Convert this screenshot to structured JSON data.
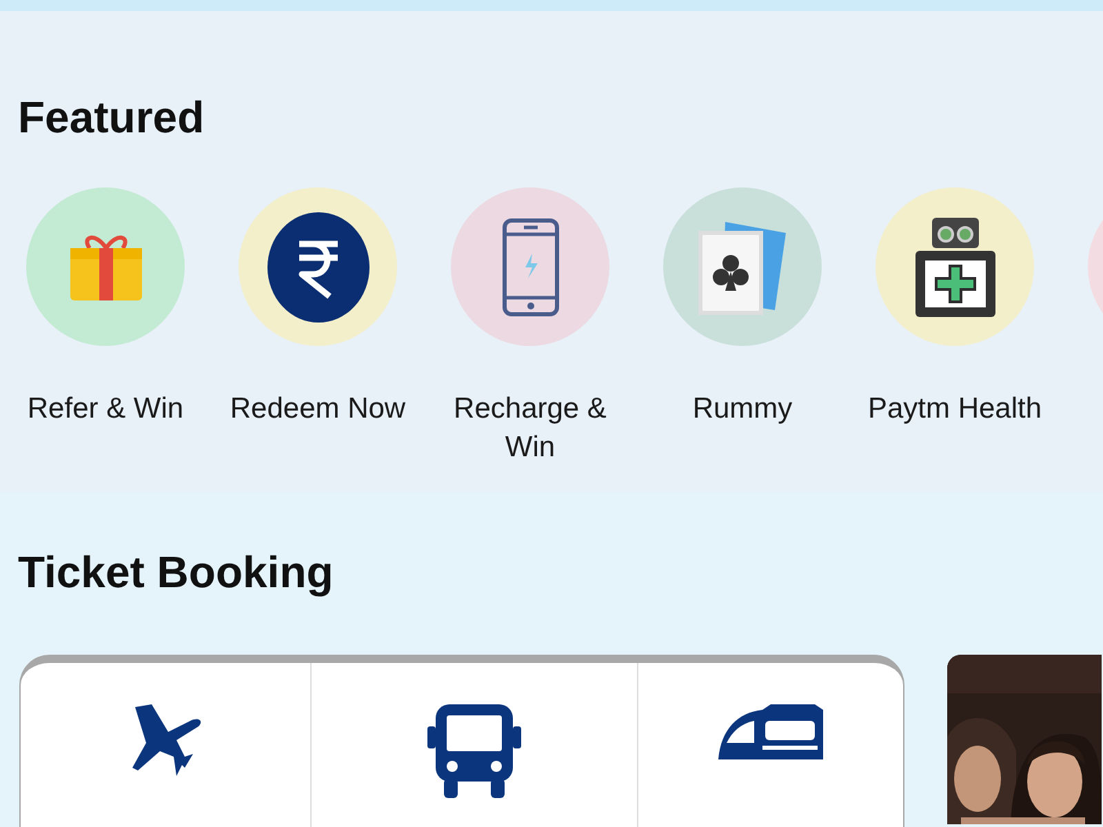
{
  "featured": {
    "title": "Featured",
    "items": [
      {
        "kind": "gift",
        "label": "Refer & Win",
        "color": "#c3ead3"
      },
      {
        "kind": "rupee",
        "label": "Redeem Now",
        "color": "#f3efcb"
      },
      {
        "kind": "phone",
        "label": "Recharge & Win",
        "color": "#ecd9e1"
      },
      {
        "kind": "cards",
        "label": "Rummy",
        "color": "#c9e0da"
      },
      {
        "kind": "health",
        "label": "Paytm Health",
        "color": "#f3efcb"
      },
      {
        "kind": "partial",
        "color": "#f3dde2"
      }
    ]
  },
  "ticket_booking": {
    "title": "Ticket Booking",
    "options": [
      {
        "kind": "flight"
      },
      {
        "kind": "bus"
      },
      {
        "kind": "train"
      }
    ]
  }
}
